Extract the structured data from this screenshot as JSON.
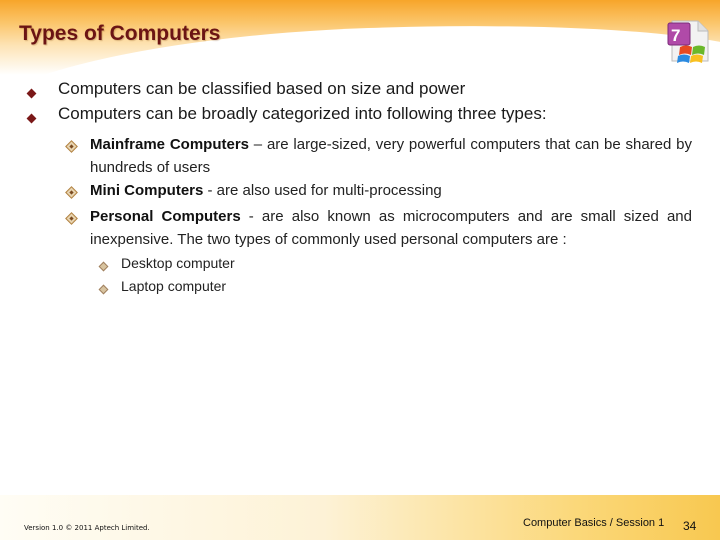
{
  "slide": {
    "title": "Types of Computers",
    "logo_icon": "office-document-logo-icon",
    "bullets": [
      {
        "text": "Computers can be classified based on size and power"
      },
      {
        "text": "Computers can be broadly categorized into following three types:"
      }
    ],
    "sub_bullets": [
      {
        "term": "Mainframe Computers",
        "desc": " – are large-sized, very powerful computers that can be shared by hundreds of users"
      },
      {
        "term": "Mini Computers",
        "desc": " - are also used for multi-processing"
      },
      {
        "term": "Personal Computers",
        "desc": " - are also known as microcomputers and are small sized and inexpensive. The two types of commonly used personal computers are :"
      }
    ],
    "sub_sub_bullets": [
      {
        "text": "Desktop computer"
      },
      {
        "text": "Laptop computer"
      }
    ]
  },
  "footer": {
    "version": "Version 1.0 © 2011 Aptech Limited.",
    "course": "Computer Basics / Session 1",
    "page_number": "34"
  },
  "colors": {
    "title": "#6b1414",
    "bullet": "#7a1818",
    "accent_orange": "#f7a52a"
  }
}
